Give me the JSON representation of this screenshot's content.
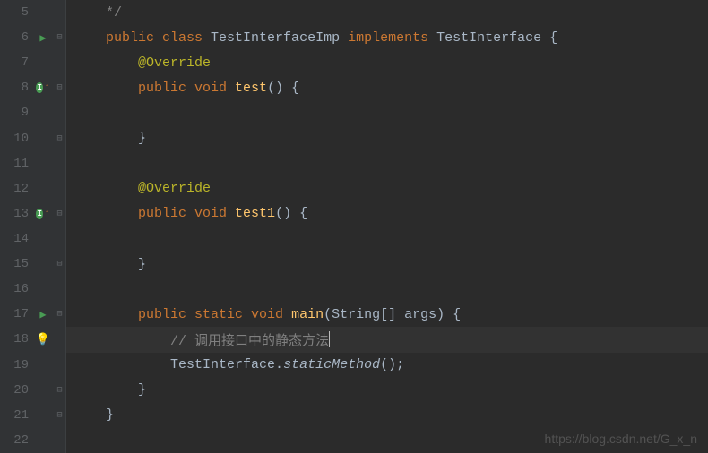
{
  "lines": [
    {
      "num": "5",
      "tokens": [
        [
          "comment",
          "    */"
        ]
      ]
    },
    {
      "num": "6",
      "run": true,
      "fold": "⊟",
      "tokens": [
        [
          "kw",
          "    public "
        ],
        [
          "kw",
          "class "
        ],
        [
          "cls",
          "TestInterfaceImp "
        ],
        [
          "kw",
          "implements "
        ],
        [
          "cls",
          "TestInterface "
        ],
        [
          "punct",
          "{"
        ]
      ]
    },
    {
      "num": "7",
      "tokens": [
        [
          "anno",
          "        @Override"
        ]
      ]
    },
    {
      "num": "8",
      "override": true,
      "fold": "⊟",
      "tokens": [
        [
          "kw",
          "        public "
        ],
        [
          "kw",
          "void "
        ],
        [
          "meth",
          "test"
        ],
        [
          "punct",
          "() {"
        ]
      ]
    },
    {
      "num": "9",
      "tokens": []
    },
    {
      "num": "10",
      "fold": "⊟",
      "tokens": [
        [
          "punct",
          "        }"
        ]
      ]
    },
    {
      "num": "11",
      "tokens": []
    },
    {
      "num": "12",
      "tokens": [
        [
          "anno",
          "        @Override"
        ]
      ]
    },
    {
      "num": "13",
      "override": true,
      "fold": "⊟",
      "tokens": [
        [
          "kw",
          "        public "
        ],
        [
          "kw",
          "void "
        ],
        [
          "meth",
          "test1"
        ],
        [
          "punct",
          "() {"
        ]
      ]
    },
    {
      "num": "14",
      "tokens": []
    },
    {
      "num": "15",
      "fold": "⊟",
      "tokens": [
        [
          "punct",
          "        }"
        ]
      ]
    },
    {
      "num": "16",
      "tokens": []
    },
    {
      "num": "17",
      "run": true,
      "fold": "⊟",
      "tokens": [
        [
          "kw",
          "        public "
        ],
        [
          "kw",
          "static "
        ],
        [
          "kw",
          "void "
        ],
        [
          "meth",
          "main"
        ],
        [
          "punct",
          "("
        ],
        [
          "param",
          "String[] args"
        ],
        [
          "punct",
          ") {"
        ]
      ]
    },
    {
      "num": "18",
      "bulb": true,
      "current": true,
      "tokens": [
        [
          "comment",
          "            // 调用接口中的静态方法"
        ]
      ],
      "cursor": true
    },
    {
      "num": "19",
      "tokens": [
        [
          "cls",
          "            TestInterface"
        ],
        [
          "punct",
          "."
        ],
        [
          "static-call",
          "staticMethod"
        ],
        [
          "punct",
          "();"
        ]
      ]
    },
    {
      "num": "20",
      "fold": "⊟",
      "tokens": [
        [
          "punct",
          "        }"
        ]
      ]
    },
    {
      "num": "21",
      "fold": "⊟",
      "tokens": [
        [
          "punct",
          "    }"
        ]
      ]
    },
    {
      "num": "22",
      "tokens": []
    }
  ],
  "watermark": "https://blog.csdn.net/G_x_n"
}
